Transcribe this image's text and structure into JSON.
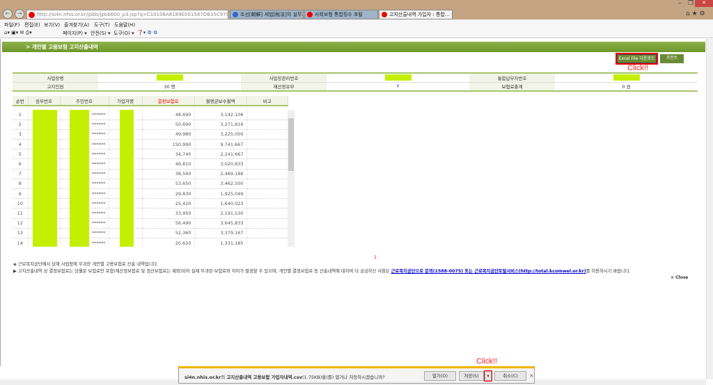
{
  "browser": {
    "url": "http://si4n.nhis.or.kr/jpbb/jpbb600_p3.jsp?q=C10108A8189E001587DB35C979620E2!",
    "tabs": [
      {
        "label": "조선[朝鮮] 세법[稅法]의 실무..."
      },
      {
        "label": "사회보험 통합징수 포털"
      },
      {
        "label": "고지산출내역 가입자 : 통합..."
      }
    ],
    "menu": [
      "파일(F)",
      "편집(E)",
      "보기(V)",
      "즐겨찾기(A)",
      "도구(T)",
      "도움말(H)"
    ],
    "toolbar": [
      "페이지(P) ▾",
      "안전(S) ▾",
      "도구(O) ▾"
    ]
  },
  "page": {
    "title": "> 개인별 고용보험 고지산출내역",
    "excel_button": "Excel File 다운로드",
    "print_button": "프린트",
    "click_label": "Click!!",
    "info": {
      "rows": [
        [
          {
            "label": "사업장명",
            "value": ""
          },
          {
            "label": "사업장관리번호",
            "value": ""
          },
          {
            "label": "통합납부자번호",
            "value": ""
          }
        ],
        [
          {
            "label": "고지인원",
            "value": "30 명"
          },
          {
            "label": "재산정유무",
            "value": "Y"
          },
          {
            "label": "보험료총계",
            "value": "0 원"
          }
        ]
      ]
    },
    "table": {
      "headers": [
        "순번",
        "원부번호",
        "주민번호",
        "가입자명",
        "결정보험료",
        "월평균보수월액",
        "비고"
      ],
      "rows": [
        {
          "no": "1",
          "rrn": "******",
          "premium": "48,690",
          "wage": "3,142,106"
        },
        {
          "no": "2",
          "rrn": "******",
          "premium": "50,690",
          "wage": "3,271,816"
        },
        {
          "no": "3",
          "rrn": "******",
          "premium": "49,980",
          "wage": "3,225,000"
        },
        {
          "no": "4",
          "rrn": "******",
          "premium": "150,990",
          "wage": "9,741,667"
        },
        {
          "no": "5",
          "rrn": "******",
          "premium": "34,740",
          "wage": "2,241,667"
        },
        {
          "no": "6",
          "rrn": "******",
          "premium": "46,810",
          "wage": "3,020,833"
        },
        {
          "no": "7",
          "rrn": "******",
          "premium": "38,560",
          "wage": "2,489,186"
        },
        {
          "no": "8",
          "rrn": "******",
          "premium": "53,650",
          "wage": "3,462,500"
        },
        {
          "no": "9",
          "rrn": "******",
          "premium": "29,830",
          "wage": "1,925,049"
        },
        {
          "no": "10",
          "rrn": "******",
          "premium": "25,420",
          "wage": "1,640,023"
        },
        {
          "no": "11",
          "rrn": "******",
          "premium": "33,950",
          "wage": "2,191,530"
        },
        {
          "no": "12",
          "rrn": "******",
          "premium": "56,490",
          "wage": "3,645,833"
        },
        {
          "no": "13",
          "rrn": "******",
          "premium": "52,360",
          "wage": "3,379,167"
        },
        {
          "no": "14",
          "rrn": "******",
          "premium": "20,620",
          "wage": "1,331,185"
        }
      ]
    },
    "pagination": "1",
    "note1": "◈ 근로복지공단에서 당해 사업장에 부과한 개인별 고용보험료 산출 내역입니다.",
    "note2": "▶ 고지산출내역 상 결정보험료는 당월분 보험료만 포함(재산정보험료 및 정산보험료는 제외)되어 실제 부과된 보험료와 차이가 발생할 수 있으며, 개인별 결정보험료 등 산출내역에 대하여 더 궁금하신 사항은 ",
    "link1": "근로복지공단으로 문의(1588-0075) 또는 ",
    "link2": "근로복지공단토탈서비스(http://total.kcomwel.or.kr)",
    "note2_end": "를 이용하시기 바랍니다.",
    "close": "Close"
  },
  "download": {
    "host": "si4n.nhis.or.kr",
    "mid": "의 ",
    "filename": "고지산출내역 고용보험 가입자내역.csv",
    "rest": "(1.75KB)을(를) 열거나 저장하시겠습니까?",
    "open": "열기(O)",
    "save": "저장(S)",
    "cancel": "취소(C)",
    "click_label": "Click!!"
  }
}
